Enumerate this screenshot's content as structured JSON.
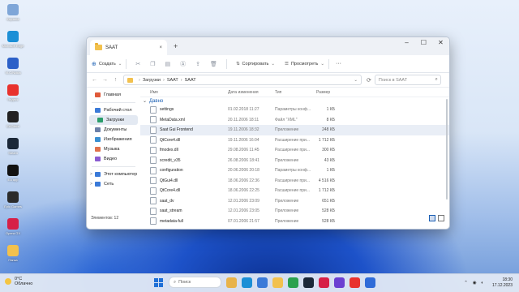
{
  "desktop": {
    "icons": [
      {
        "label": "Корзина",
        "color": "#7fa6d8"
      },
      {
        "label": "Microsoft Edge",
        "color": "#1b8fd6"
      },
      {
        "label": "VLC/Nokia",
        "color": "#2b60c8"
      },
      {
        "label": "Яндекс",
        "color": "#e8322d"
      },
      {
        "label": "EAClient",
        "color": "#222"
      },
      {
        "label": "Steam",
        "color": "#1b2838"
      },
      {
        "label": "EA app",
        "color": "#111"
      },
      {
        "label": "Epic Games",
        "color": "#2b2b2b"
      },
      {
        "label": "Opera GX",
        "color": "#d62047"
      },
      {
        "label": "Папка",
        "color": "#f2c14e"
      }
    ]
  },
  "window": {
    "tab_title": "SAAT",
    "tab_close": "×",
    "new_tab": "+",
    "controls": {
      "minimize": "–",
      "maximize": "☐",
      "close": "✕"
    },
    "toolbar": {
      "create_label": "Создать",
      "sort_label": "Сортировать",
      "view_label": "Просмотреть",
      "more_label": "···"
    },
    "address": {
      "crumbs": [
        "Загрузки",
        "SAAT",
        "SAAT"
      ],
      "search_placeholder": "Поиск в SAAT"
    },
    "sidebar": {
      "items": [
        {
          "label": "Главная",
          "color": "#e05a3a",
          "chev": ""
        },
        {
          "label": "Рабочий стол",
          "color": "#3b7ad8",
          "chev": ""
        },
        {
          "label": "Загрузки",
          "color": "#2a9d6b",
          "chev": ""
        },
        {
          "label": "Документы",
          "color": "#6b7fa8",
          "chev": ""
        },
        {
          "label": "Изображения",
          "color": "#3a8fd1",
          "chev": ""
        },
        {
          "label": "Музыка",
          "color": "#e0704a",
          "chev": ""
        },
        {
          "label": "Видео",
          "color": "#8a5bd1",
          "chev": ""
        },
        {
          "label": "Этот компьютер",
          "color": "#3b7ad8",
          "chev": ">"
        },
        {
          "label": "Сеть",
          "color": "#3b7ad8",
          "chev": ">"
        }
      ]
    },
    "columns": {
      "name": "Имя",
      "date": "Дата изменения",
      "type": "Тип",
      "size": "Размер"
    },
    "group_label": "Давно",
    "files": [
      {
        "name": "settings",
        "date": "01.02.2018 11:27",
        "type": "Параметры конф...",
        "size": "1 КБ"
      },
      {
        "name": "MetaData.xml",
        "date": "20.11.2006 18:11",
        "type": "Файл \"XML\"",
        "size": "8 КБ"
      },
      {
        "name": "Saat Gui Frontend",
        "date": "19.11.2006 18:32",
        "type": "Приложение",
        "size": "248 КБ"
      },
      {
        "name": "QtCore4.dll",
        "date": "19.11.2006 16:04",
        "type": "Расширение при...",
        "size": "1 712 КБ"
      },
      {
        "name": "fmodex.dll",
        "date": "29.08.2006 11:45",
        "type": "Расширение при...",
        "size": "300 КБ"
      },
      {
        "name": "xcredit_v35",
        "date": "26.08.2006 18:41",
        "type": "Приложение",
        "size": "43 КБ"
      },
      {
        "name": "configuration",
        "date": "20.06.2006 20:18",
        "type": "Параметры конф...",
        "size": "1 КБ"
      },
      {
        "name": "QtGui4.dll",
        "date": "18.06.2006 22:36",
        "type": "Расширение при...",
        "size": "4 516 КБ"
      },
      {
        "name": "QtCore4.dll",
        "date": "18.06.2006 22:25",
        "type": "Расширение при...",
        "size": "1 712 КБ"
      },
      {
        "name": "saat_dv",
        "date": "12.01.2006 23:09",
        "type": "Приложение",
        "size": "651 КБ"
      },
      {
        "name": "saat_stream",
        "date": "12.01.2006 23:05",
        "type": "Приложение",
        "size": "528 КБ"
      },
      {
        "name": "metadata-full",
        "date": "07.01.2006 21:57",
        "type": "Приложение",
        "size": "528 КБ"
      }
    ],
    "status": "Элементов: 12"
  },
  "taskbar": {
    "weather_temp": "0°C",
    "weather_desc": "Облачно",
    "search_placeholder": "Поиск",
    "time": "18:30",
    "date": "17.12.2023",
    "apps": [
      "#e8b34a",
      "#1b8fd6",
      "#3a7ad8",
      "#f2c14e",
      "#2aa14e",
      "#1b2838",
      "#d62047",
      "#6b3fd1",
      "#e8322d",
      "#2f6bd8"
    ]
  }
}
